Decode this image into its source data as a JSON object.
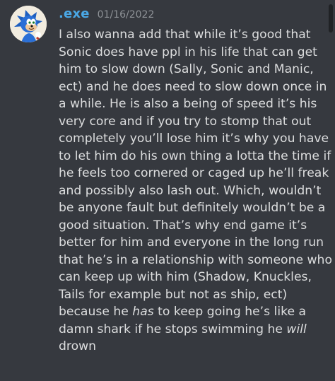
{
  "message": {
    "username": ".exe",
    "timestamp": "01/16/2022",
    "avatar_icon": "sonic-avatar-icon",
    "lines": [
      "I also wanna add that while it’s good that",
      "Sonic does have ppl in his life that can get",
      "him to slow down (Sally, Sonic and Manic,",
      "ect) and he does need to slow down once in",
      "a while. He is also a being of speed it’s his",
      "very core and if you try to stomp that out",
      "completely you’ll lose him it’s why you have",
      "to let him do his own thing a lotta the time if",
      "he feels too cornered or caged up he’ll freak",
      "and possibly also lash out. Which, wouldn’t",
      "be anyone fault but definitely wouldn’t be a",
      "good situation. That’s why end game it’s",
      "better for him and everyone in the long run",
      "that he’s in a relationship with someone who",
      "can keep up with him (Shadow, Knuckles,",
      "Tails for example but not as ship, ect)"
    ],
    "line17": {
      "before": "because he ",
      "em": "has",
      "after": " to keep going he’s like a"
    },
    "line18": {
      "before": "damn shark if he stops swimming he ",
      "em": "will"
    },
    "line19": "drown"
  },
  "colors": {
    "background": "#36393f",
    "username": "#4aa8e6",
    "timestamp": "#8e9297",
    "text": "#dcddde"
  }
}
